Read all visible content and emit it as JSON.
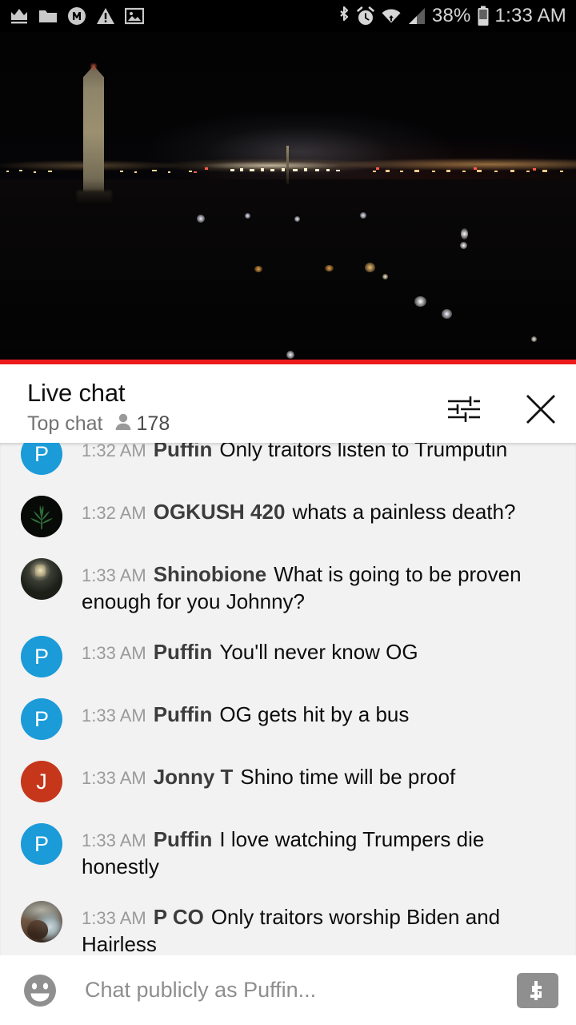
{
  "status_bar": {
    "left_icons": [
      {
        "name": "crown-icon",
        "glyph": "crown"
      },
      {
        "name": "folder-icon",
        "glyph": "folder"
      },
      {
        "name": "m-circle-icon",
        "glyph": "m-circle"
      },
      {
        "name": "warning-triangle-icon",
        "glyph": "warning"
      },
      {
        "name": "image-icon",
        "glyph": "image"
      }
    ],
    "right_icons": [
      {
        "name": "bluetooth-icon",
        "glyph": "bluetooth"
      },
      {
        "name": "alarm-icon",
        "glyph": "alarm"
      },
      {
        "name": "wifi-icon",
        "glyph": "wifi"
      },
      {
        "name": "cell-signal-icon",
        "glyph": "signal"
      }
    ],
    "battery_percent": "38%",
    "battery_icon": "battery-icon",
    "clock": "1:33 AM"
  },
  "video": {
    "name": "live-video-player",
    "description": "Night view of the Washington Monument with city lights",
    "progress_bar_color": "#ec1b1b"
  },
  "chat_header": {
    "title": "Live chat",
    "subtitle": "Top chat",
    "viewer_icon": "person-icon",
    "viewer_count": "178",
    "settings_icon": "chat-settings-icon",
    "close_icon": "close-icon"
  },
  "messages": [
    {
      "avatar": {
        "type": "initial",
        "initial": "P",
        "color": "#1b9bd8"
      },
      "timestamp": "1:32 AM",
      "author": "Puffin",
      "text": "Only traitors listen to Trumputin",
      "clipped": true
    },
    {
      "avatar": {
        "type": "photo-leaf",
        "initial": "",
        "color": "#070a07"
      },
      "timestamp": "1:32 AM",
      "author": "OGKUSH 420",
      "text": "whats a painless death?",
      "clipped": false
    },
    {
      "avatar": {
        "type": "photo-dark",
        "initial": "",
        "color": "#1b1f18"
      },
      "timestamp": "1:33 AM",
      "author": "Shinobione",
      "text": "What is going to be proven enough for you Johnny?",
      "clipped": false
    },
    {
      "avatar": {
        "type": "initial",
        "initial": "P",
        "color": "#1b9bd8"
      },
      "timestamp": "1:33 AM",
      "author": "Puffin",
      "text": "You'll never know OG",
      "clipped": false
    },
    {
      "avatar": {
        "type": "initial",
        "initial": "P",
        "color": "#1b9bd8"
      },
      "timestamp": "1:33 AM",
      "author": "Puffin",
      "text": "OG gets hit by a bus",
      "clipped": false
    },
    {
      "avatar": {
        "type": "initial",
        "initial": "J",
        "color": "#c5361b"
      },
      "timestamp": "1:33 AM",
      "author": "Jonny T",
      "text": "Shino time will be proof",
      "clipped": false
    },
    {
      "avatar": {
        "type": "initial",
        "initial": "P",
        "color": "#1b9bd8"
      },
      "timestamp": "1:33 AM",
      "author": "Puffin",
      "text": "I love watching Trumpers die honestly",
      "clipped": false
    },
    {
      "avatar": {
        "type": "photo-man",
        "initial": "",
        "color": "#6d5440"
      },
      "timestamp": "1:33 AM",
      "author": "P CO",
      "text": "Only traitors worship Biden and Hairless",
      "clipped": false
    }
  ],
  "input_bar": {
    "emoji_icon": "emoji-smiley-icon",
    "placeholder": "Chat publicly as Puffin...",
    "value": "",
    "superchat_icon": "dollar-icon"
  },
  "colors": {
    "accent_red": "#ec1b1b",
    "chat_background": "#f2f2f2",
    "panel_background": "#ffffff",
    "avatar_blue": "#1b9bd8",
    "avatar_red": "#c5361b"
  }
}
